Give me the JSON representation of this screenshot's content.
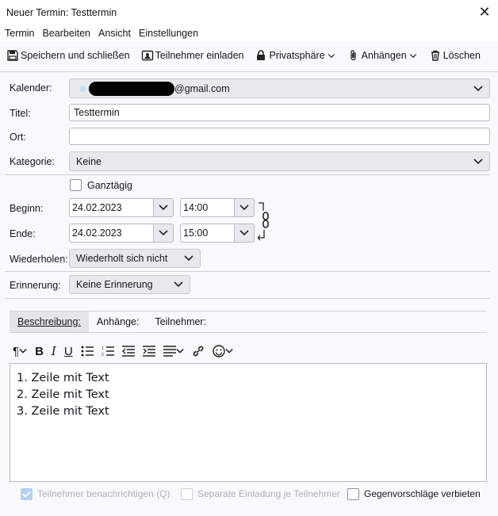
{
  "window": {
    "title": "Neuer Termin: Testtermin"
  },
  "menu": {
    "items": [
      "Termin",
      "Bearbeiten",
      "Ansicht",
      "Einstellungen"
    ]
  },
  "toolbar": {
    "save": "Speichern und schließen",
    "invite": "Teilnehmer einladen",
    "privacy": "Privatsphäre",
    "attachments": "Anhängen",
    "delete": "Löschen"
  },
  "form": {
    "calendar_label": "Kalender:",
    "calendar_value": "@gmail.com",
    "title_label": "Titel:",
    "title_value": "Testtermin",
    "location_label": "Ort:",
    "location_value": "",
    "category_label": "Kategorie:",
    "category_value": "Keine",
    "allday_label": "Ganztägig",
    "start_label": "Beginn:",
    "start_date": "24.02.2023",
    "start_time": "14:00",
    "end_label": "Ende:",
    "end_date": "24.02.2023",
    "end_time": "15:00",
    "repeat_label": "Wiederholen:",
    "repeat_value": "Wiederholt sich nicht",
    "reminder_label": "Erinnerung:",
    "reminder_value": "Keine Erinnerung"
  },
  "tabs": [
    "Beschreibung:",
    "Anhänge:",
    "Teilnehmer:"
  ],
  "editor": {
    "lines": [
      "1. Zeile mit Text",
      "2. Zeile mit Text",
      "3. Zeile mit Text"
    ]
  },
  "footer": {
    "notify": "Teilnehmer benachrichtigen (Q)",
    "separate": "Separate Einladung je Teilnehmer",
    "no_counter": "Gegenvorschläge verbieten"
  },
  "colors": {
    "accent": "#0061e0",
    "redacted": "#000000"
  }
}
